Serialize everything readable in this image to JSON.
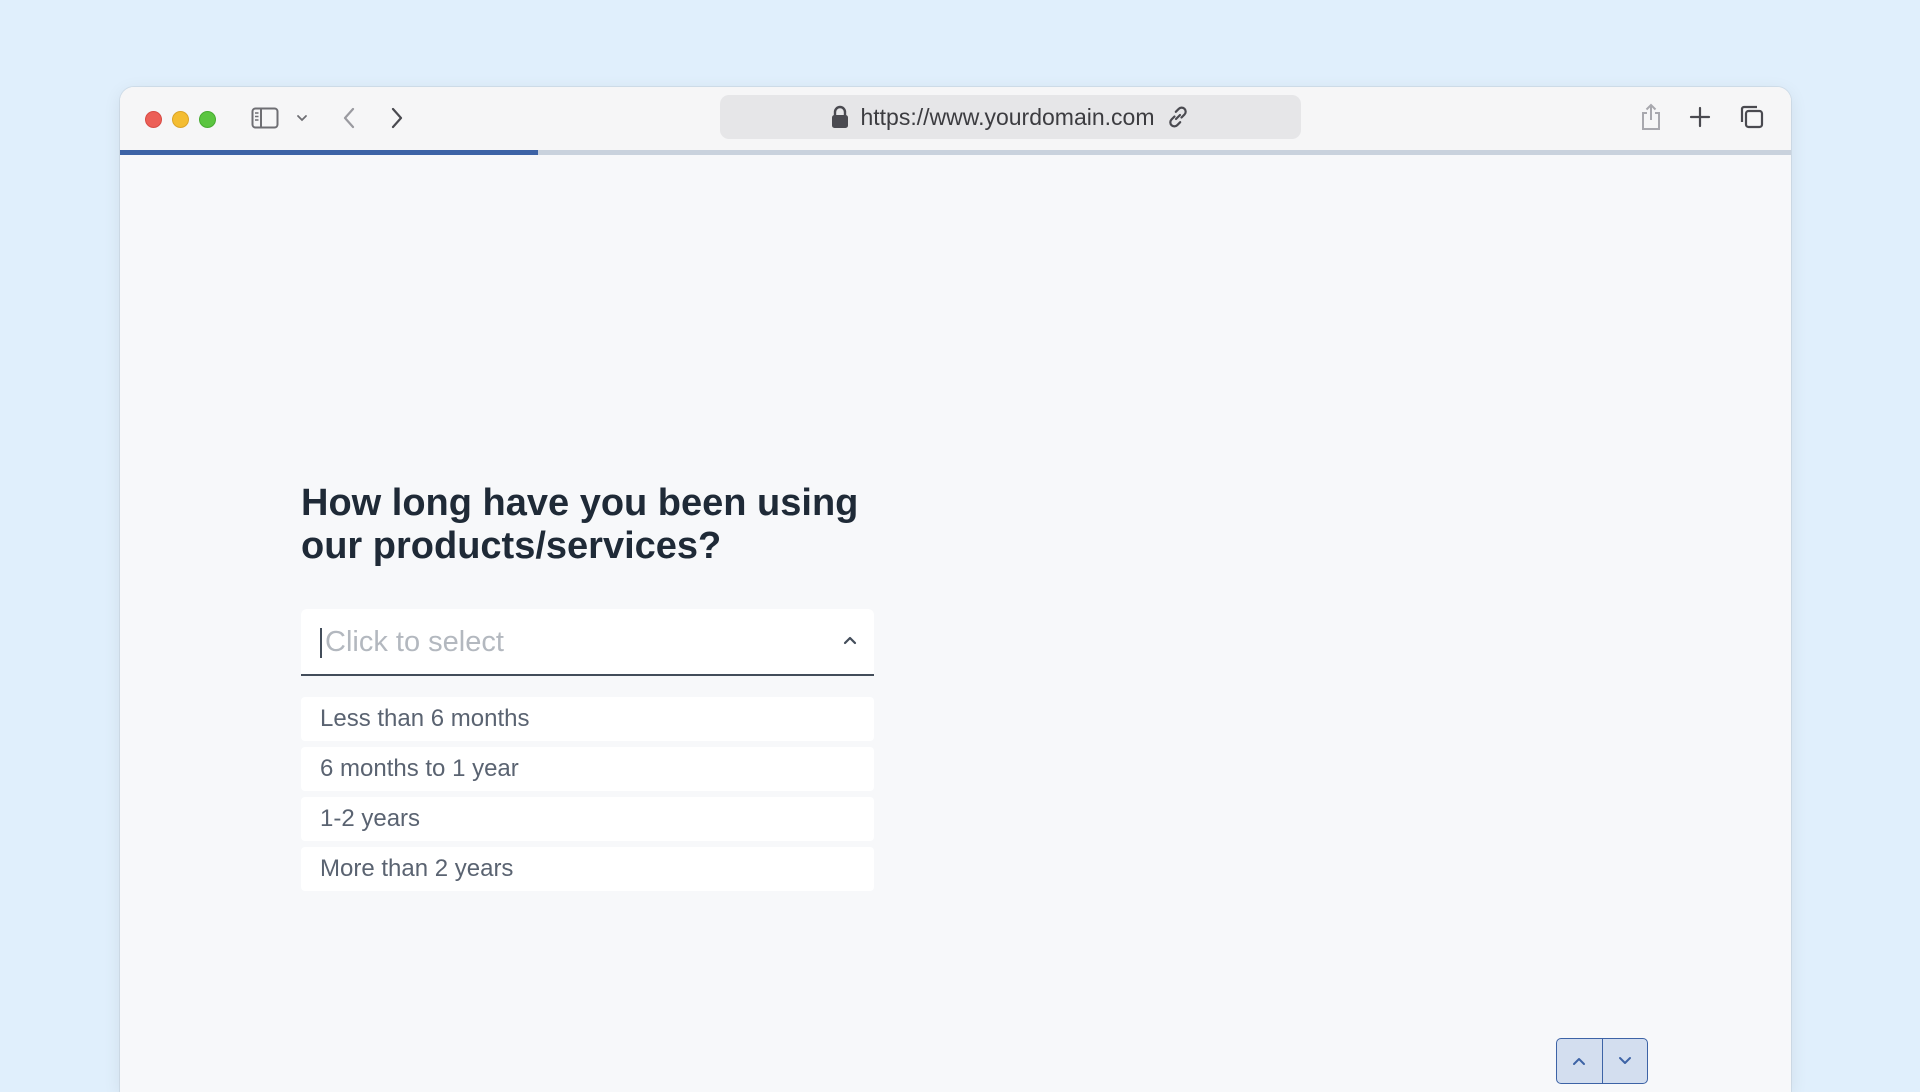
{
  "browser": {
    "url": "https://www.yourdomain.com",
    "progress_fraction": 0.25
  },
  "form": {
    "question": "How long have you been using our products/services?",
    "select_placeholder": "Click to select",
    "options": [
      "Less than 6 months",
      "6 months to 1 year",
      "1-2 years",
      "More than 2 years"
    ]
  },
  "colors": {
    "page_background": "#e0effc",
    "accent": "#3d63a6",
    "question_text": "#1f2a37"
  },
  "icons": {
    "sidebar": "sidebar-icon",
    "back": "chevron-left-icon",
    "forward": "chevron-right-icon",
    "lock": "lock-icon",
    "link": "link-icon",
    "share": "share-icon",
    "new_tab": "plus-icon",
    "tabs": "tabs-overview-icon",
    "nav_up": "chevron-up-icon",
    "nav_down": "chevron-down-icon"
  }
}
